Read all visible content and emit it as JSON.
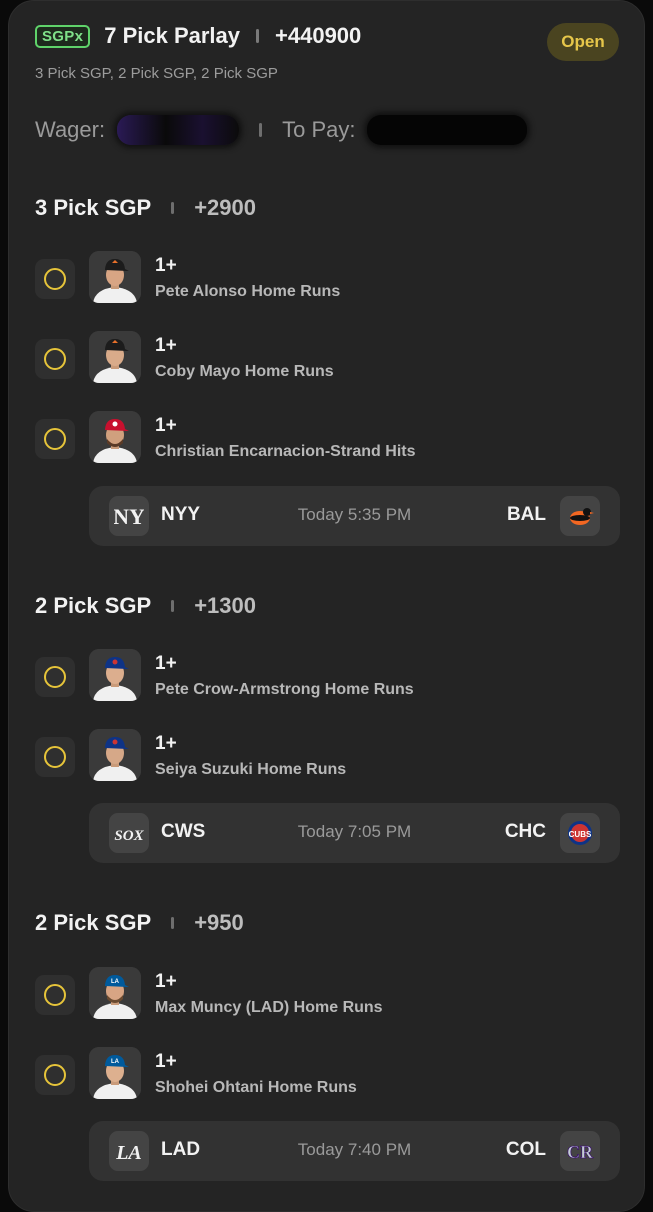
{
  "parlay": {
    "badge": "SGPx",
    "title": "7 Pick Parlay",
    "odds": "+440900",
    "status": "Open",
    "subtitle": "3 Pick SGP, 2 Pick SGP, 2 Pick SGP",
    "wager_label": "Wager:",
    "to_pay_label": "To Pay:"
  },
  "sections": [
    {
      "title": "3 Pick SGP",
      "odds": "+2900",
      "legs": [
        {
          "line": "1+",
          "desc": "Pete Alonso Home Runs"
        },
        {
          "line": "1+",
          "desc": "Coby Mayo Home Runs"
        },
        {
          "line": "1+",
          "desc": "Christian Encarnacion-Strand Hits"
        }
      ],
      "game": {
        "away": "NYY",
        "time": "Today 5:35 PM",
        "home": "BAL"
      }
    },
    {
      "title": "2 Pick SGP",
      "odds": "+1300",
      "legs": [
        {
          "line": "1+",
          "desc": "Pete Crow-Armstrong Home Runs"
        },
        {
          "line": "1+",
          "desc": "Seiya Suzuki Home Runs"
        }
      ],
      "game": {
        "away": "CWS",
        "time": "Today 7:05 PM",
        "home": "CHC"
      }
    },
    {
      "title": "2 Pick SGP",
      "odds": "+950",
      "legs": [
        {
          "line": "1+",
          "desc": "Max Muncy (LAD) Home Runs"
        },
        {
          "line": "1+",
          "desc": "Shohei Ohtani Home Runs"
        }
      ],
      "game": {
        "away": "LAD",
        "time": "Today 7:40 PM",
        "home": "COL"
      }
    }
  ],
  "icons": {
    "radio": "empty-radio-icon",
    "headshot": "player-headshot-icon",
    "logos": [
      "yankees-logo-icon",
      "orioles-logo-icon",
      "white-sox-logo-icon",
      "cubs-logo-icon",
      "dodgers-logo-icon",
      "rockies-logo-icon"
    ]
  },
  "colors": {
    "background": "#242424",
    "accent_green": "#5fd36a",
    "accent_yellow": "#e6c43a",
    "open_badge_bg": "#4a4420"
  }
}
